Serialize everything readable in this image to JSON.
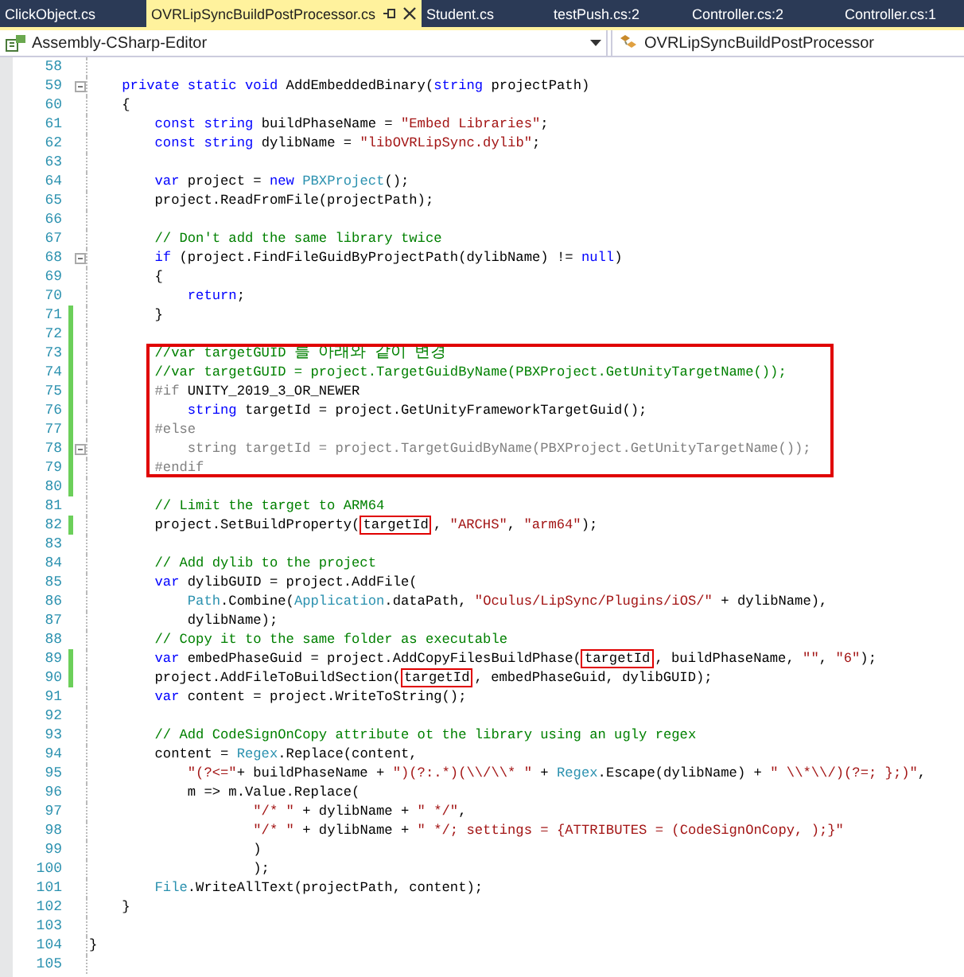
{
  "tabs": [
    {
      "label": "ClickObject.cs",
      "selected": false
    },
    {
      "label": "OVRLipSyncBuildPostProcessor.cs",
      "selected": true
    },
    {
      "label": "Student.cs",
      "selected": false
    },
    {
      "label": "testPush.cs:2",
      "selected": false
    },
    {
      "label": "Controller.cs:2",
      "selected": false
    },
    {
      "label": "Controller.cs:1",
      "selected": false
    }
  ],
  "navigation": {
    "project": "Assembly-CSharp-Editor",
    "class": "OVRLipSyncBuildPostProcessor"
  },
  "code": {
    "blocks": [
      {
        "highlighted": false,
        "lines": [
          {
            "number": "58",
            "changed": false,
            "foldable": false
          },
          {
            "number": "59",
            "changed": false,
            "foldable": true,
            "segments": [
              {
                "text": "    private",
                "kind": "keyword"
              },
              {
                "text": " static",
                "kind": "keyword"
              },
              {
                "text": " void",
                "kind": "keyword"
              },
              {
                "text": " AddEmbeddedBinary(",
                "kind": "plain"
              },
              {
                "text": "string",
                "kind": "keyword"
              },
              {
                "text": " projectPath)",
                "kind": "plain"
              }
            ]
          },
          {
            "number": "60",
            "changed": false,
            "foldable": false,
            "segments": [
              {
                "text": "    {",
                "kind": "plain"
              }
            ]
          },
          {
            "number": "61",
            "changed": false,
            "foldable": false,
            "segments": [
              {
                "text": "        const",
                "kind": "keyword"
              },
              {
                "text": " string",
                "kind": "keyword"
              },
              {
                "text": " buildPhaseName = ",
                "kind": "plain"
              },
              {
                "text": "\"Embed Libraries\"",
                "kind": "string"
              },
              {
                "text": ";",
                "kind": "plain"
              }
            ]
          },
          {
            "number": "62",
            "changed": false,
            "foldable": false,
            "segments": [
              {
                "text": "        const",
                "kind": "keyword"
              },
              {
                "text": " string",
                "kind": "keyword"
              },
              {
                "text": " dylibName = ",
                "kind": "plain"
              },
              {
                "text": "\"libOVRLipSync.dylib\"",
                "kind": "string"
              },
              {
                "text": ";",
                "kind": "plain"
              }
            ]
          },
          {
            "number": "63",
            "changed": false,
            "foldable": false
          },
          {
            "number": "64",
            "changed": false,
            "foldable": false,
            "segments": [
              {
                "text": "        var",
                "kind": "keyword"
              },
              {
                "text": " project = ",
                "kind": "plain"
              },
              {
                "text": "new",
                "kind": "keyword"
              },
              {
                "text": " PBXProject",
                "kind": "type"
              },
              {
                "text": "();",
                "kind": "plain"
              }
            ]
          },
          {
            "number": "65",
            "changed": false,
            "foldable": false,
            "segments": [
              {
                "text": "        project.ReadFromFile(projectPath);",
                "kind": "plain"
              }
            ]
          },
          {
            "number": "66",
            "changed": false,
            "foldable": false
          },
          {
            "number": "67",
            "changed": false,
            "foldable": false,
            "segments": [
              {
                "text": "        // Don't add the same library twice",
                "kind": "comment"
              }
            ]
          },
          {
            "number": "68",
            "changed": false,
            "foldable": true,
            "segments": [
              {
                "text": "        if",
                "kind": "keyword"
              },
              {
                "text": " (project.FindFileGuidByProjectPath(dylibName) != ",
                "kind": "plain"
              },
              {
                "text": "null",
                "kind": "keyword"
              },
              {
                "text": ")",
                "kind": "plain"
              }
            ]
          },
          {
            "number": "69",
            "changed": false,
            "foldable": false,
            "segments": [
              {
                "text": "        {",
                "kind": "plain"
              }
            ]
          },
          {
            "number": "70",
            "changed": false,
            "foldable": false,
            "segments": [
              {
                "text": "            return",
                "kind": "keyword"
              },
              {
                "text": ";",
                "kind": "plain"
              }
            ]
          },
          {
            "number": "71",
            "changed": true,
            "foldable": false,
            "segments": [
              {
                "text": "        }",
                "kind": "plain"
              }
            ]
          },
          {
            "number": "72",
            "changed": true,
            "foldable": false
          }
        ]
      },
      {
        "highlighted": true,
        "lines": [
          {
            "number": "73",
            "changed": true,
            "foldable": false,
            "segments": [
              {
                "text": "        //var targetGUID 를 아래와 같이 변경",
                "kind": "comment"
              }
            ]
          },
          {
            "number": "74",
            "changed": true,
            "foldable": false,
            "segments": [
              {
                "text": "        //var targetGUID = project.TargetGuidByName(PBXProject.GetUnityTargetName());",
                "kind": "comment"
              }
            ]
          },
          {
            "number": "75",
            "changed": true,
            "foldable": false,
            "segments": [
              {
                "text": "        #if",
                "kind": "preprocessor"
              },
              {
                "text": " UNITY_2019_3_OR_NEWER",
                "kind": "plain"
              }
            ]
          },
          {
            "number": "76",
            "changed": true,
            "foldable": false,
            "segments": [
              {
                "text": "            string",
                "kind": "keyword"
              },
              {
                "text": " targetId = project.GetUnityFrameworkTargetGuid();",
                "kind": "plain"
              }
            ]
          },
          {
            "number": "77",
            "changed": true,
            "foldable": false,
            "segments": [
              {
                "text": "        #else",
                "kind": "inactive"
              }
            ]
          },
          {
            "number": "78",
            "changed": true,
            "foldable": true,
            "segments": [
              {
                "text": "            string targetId = project.TargetGuidByName(PBXProject.GetUnityTargetName());",
                "kind": "inactive"
              }
            ]
          },
          {
            "number": "79",
            "changed": true,
            "foldable": false,
            "segments": [
              {
                "text": "        #endif",
                "kind": "inactive"
              }
            ]
          }
        ]
      },
      {
        "highlighted": false,
        "lines": [
          {
            "number": "80",
            "changed": true,
            "foldable": false
          },
          {
            "number": "81",
            "changed": false,
            "foldable": false,
            "segments": [
              {
                "text": "        // Limit the target to ARM64",
                "kind": "comment"
              }
            ]
          },
          {
            "number": "82",
            "changed": true,
            "foldable": false,
            "segments": [
              {
                "text": "        project.SetBuildProperty(",
                "kind": "plain"
              },
              {
                "text": "targetId",
                "kind": "plain",
                "boxed": true
              },
              {
                "text": ", ",
                "kind": "plain"
              },
              {
                "text": "\"ARCHS\"",
                "kind": "string"
              },
              {
                "text": ", ",
                "kind": "plain"
              },
              {
                "text": "\"arm64\"",
                "kind": "string"
              },
              {
                "text": ");",
                "kind": "plain"
              }
            ]
          },
          {
            "number": "83",
            "changed": false,
            "foldable": false
          },
          {
            "number": "84",
            "changed": false,
            "foldable": false,
            "segments": [
              {
                "text": "        // Add dylib to the project",
                "kind": "comment"
              }
            ]
          },
          {
            "number": "85",
            "changed": false,
            "foldable": false,
            "segments": [
              {
                "text": "        var",
                "kind": "keyword"
              },
              {
                "text": " dylibGUID = project.AddFile(",
                "kind": "plain"
              }
            ]
          },
          {
            "number": "86",
            "changed": false,
            "foldable": false,
            "segments": [
              {
                "text": "            Path",
                "kind": "type"
              },
              {
                "text": ".Combine(",
                "kind": "plain"
              },
              {
                "text": "Application",
                "kind": "type"
              },
              {
                "text": ".dataPath, ",
                "kind": "plain"
              },
              {
                "text": "\"Oculus/LipSync/Plugins/iOS/\"",
                "kind": "string"
              },
              {
                "text": " + dylibName),",
                "kind": "plain"
              }
            ]
          },
          {
            "number": "87",
            "changed": false,
            "foldable": false,
            "segments": [
              {
                "text": "            dylibName);",
                "kind": "plain"
              }
            ]
          },
          {
            "number": "88",
            "changed": false,
            "foldable": false,
            "segments": [
              {
                "text": "        // Copy it to the same folder as executable",
                "kind": "comment"
              }
            ]
          },
          {
            "number": "89",
            "changed": true,
            "foldable": false,
            "segments": [
              {
                "text": "        var",
                "kind": "keyword"
              },
              {
                "text": " embedPhaseGuid = project.AddCopyFilesBuildPhase(",
                "kind": "plain"
              },
              {
                "text": "targetId",
                "kind": "plain",
                "boxed": true
              },
              {
                "text": ", buildPhaseName, ",
                "kind": "plain"
              },
              {
                "text": "\"\"",
                "kind": "string"
              },
              {
                "text": ", ",
                "kind": "plain"
              },
              {
                "text": "\"6\"",
                "kind": "string"
              },
              {
                "text": ");",
                "kind": "plain"
              }
            ]
          },
          {
            "number": "90",
            "changed": true,
            "foldable": false,
            "segments": [
              {
                "text": "        project.AddFileToBuildSection(",
                "kind": "plain"
              },
              {
                "text": "targetId",
                "kind": "plain",
                "boxed": true
              },
              {
                "text": ", embedPhaseGuid, dylibGUID);",
                "kind": "plain"
              }
            ]
          },
          {
            "number": "91",
            "changed": false,
            "foldable": false,
            "segments": [
              {
                "text": "        var",
                "kind": "keyword"
              },
              {
                "text": " content = project.WriteToString();",
                "kind": "plain"
              }
            ]
          },
          {
            "number": "92",
            "changed": false,
            "foldable": false
          },
          {
            "number": "93",
            "changed": false,
            "foldable": false,
            "segments": [
              {
                "text": "        // Add CodeSignOnCopy attribute ot the library using an ugly regex",
                "kind": "comment"
              }
            ]
          },
          {
            "number": "94",
            "changed": false,
            "foldable": false,
            "segments": [
              {
                "text": "        content = ",
                "kind": "plain"
              },
              {
                "text": "Regex",
                "kind": "type"
              },
              {
                "text": ".Replace(content,",
                "kind": "plain"
              }
            ]
          },
          {
            "number": "95",
            "changed": false,
            "foldable": false,
            "segments": [
              {
                "text": "            \"(?<=\"",
                "kind": "string"
              },
              {
                "text": "+ buildPhaseName + ",
                "kind": "plain"
              },
              {
                "text": "\")(?:.*)(\\\\/\\\\* \"",
                "kind": "string"
              },
              {
                "text": " + ",
                "kind": "plain"
              },
              {
                "text": "Regex",
                "kind": "type"
              },
              {
                "text": ".Escape(dylibName) + ",
                "kind": "plain"
              },
              {
                "text": "\" \\\\*\\\\/)(?=; };)\"",
                "kind": "string"
              },
              {
                "text": ",",
                "kind": "plain"
              }
            ]
          },
          {
            "number": "96",
            "changed": false,
            "foldable": false,
            "segments": [
              {
                "text": "            m => m.Value.Replace(",
                "kind": "plain"
              }
            ]
          },
          {
            "number": "97",
            "changed": false,
            "foldable": false,
            "segments": [
              {
                "text": "                    \"/* \"",
                "kind": "string"
              },
              {
                "text": " + dylibName + ",
                "kind": "plain"
              },
              {
                "text": "\" */\"",
                "kind": "string"
              },
              {
                "text": ",",
                "kind": "plain"
              }
            ]
          },
          {
            "number": "98",
            "changed": false,
            "foldable": false,
            "segments": [
              {
                "text": "                    \"/* \"",
                "kind": "string"
              },
              {
                "text": " + dylibName + ",
                "kind": "plain"
              },
              {
                "text": "\" */; settings = {ATTRIBUTES = (CodeSignOnCopy, );}\"",
                "kind": "string"
              }
            ]
          },
          {
            "number": "99",
            "changed": false,
            "foldable": false,
            "segments": [
              {
                "text": "                    )",
                "kind": "plain"
              }
            ]
          },
          {
            "number": "100",
            "changed": false,
            "foldable": false,
            "segments": [
              {
                "text": "                    );",
                "kind": "plain"
              }
            ]
          },
          {
            "number": "101",
            "changed": false,
            "foldable": false,
            "segments": [
              {
                "text": "        File",
                "kind": "type"
              },
              {
                "text": ".WriteAllText(projectPath, content);",
                "kind": "plain"
              }
            ]
          },
          {
            "number": "102",
            "changed": false,
            "foldable": false,
            "segments": [
              {
                "text": "    }",
                "kind": "plain"
              }
            ]
          },
          {
            "number": "103",
            "changed": false,
            "foldable": false
          },
          {
            "number": "104",
            "changed": false,
            "foldable": false,
            "segments": [
              {
                "text": "}",
                "kind": "plain"
              }
            ]
          },
          {
            "number": "105",
            "changed": false,
            "foldable": false
          }
        ]
      }
    ]
  }
}
